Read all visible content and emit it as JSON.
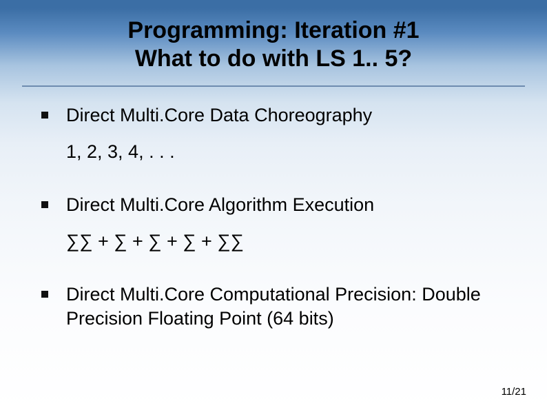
{
  "title": {
    "line1": "Programming: Iteration #1",
    "line2": "What to do with LS 1.. 5?"
  },
  "bullets": [
    {
      "text": "Direct Multi.Core Data Choreography",
      "sub": "1, 2, 3, 4, . . ."
    },
    {
      "text": "Direct Multi.Core Algorithm Execution",
      "sub": "∑∑ + ∑ + ∑ + ∑ + ∑∑"
    },
    {
      "text": "Direct Multi.Core Computational Precision: Double Precision Floating Point (64 bits)",
      "sub": null
    }
  ],
  "page": "11/21"
}
